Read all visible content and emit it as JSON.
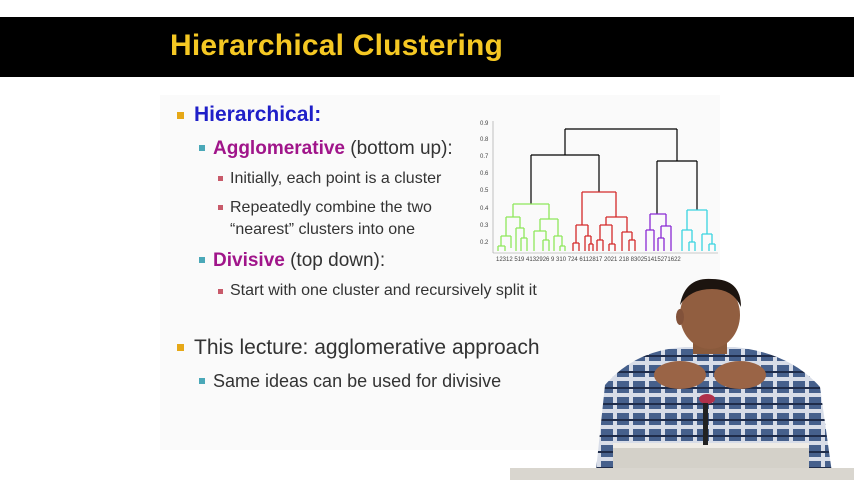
{
  "slide": {
    "title": "Hierarchical Clustering",
    "bullets": {
      "hierarchical": "Hierarchical:",
      "agglomerative_term": "Agglomerative",
      "agglomerative_desc": "(bottom up):",
      "initially": "Initially, each point is a cluster",
      "repeatedly_line1": "Repeatedly combine the two",
      "repeatedly_line2": "“nearest” clusters into one",
      "divisive_term": "Divisive",
      "divisive_desc": "(top down):",
      "start_with": "Start with one cluster and recursively split it",
      "this_lecture": "This lecture: agglomerative approach",
      "same_ideas": "Same ideas can be used for divisive"
    }
  },
  "dendrogram": {
    "y_ticks": [
      "0.9",
      "0.8",
      "0.7",
      "0.6",
      "0.5",
      "0.4",
      "0.3",
      "0.2"
    ],
    "x_labels": "12312 519 4132926 9  310 724 6112817 2021 218  830251415271622"
  },
  "colors": {
    "title": "#f5c823",
    "hierarchical": "#1f1fc8",
    "term": "#a0158a",
    "bullet_l1": "#e6a817",
    "bullet_l2": "#4aa8b8",
    "bullet_l3": "#c85a6a",
    "cluster_green": "#8ee85a",
    "cluster_red": "#d42a2a",
    "cluster_purple": "#8a2ad4",
    "cluster_cyan": "#3ad4e0",
    "link_black": "#000000"
  }
}
